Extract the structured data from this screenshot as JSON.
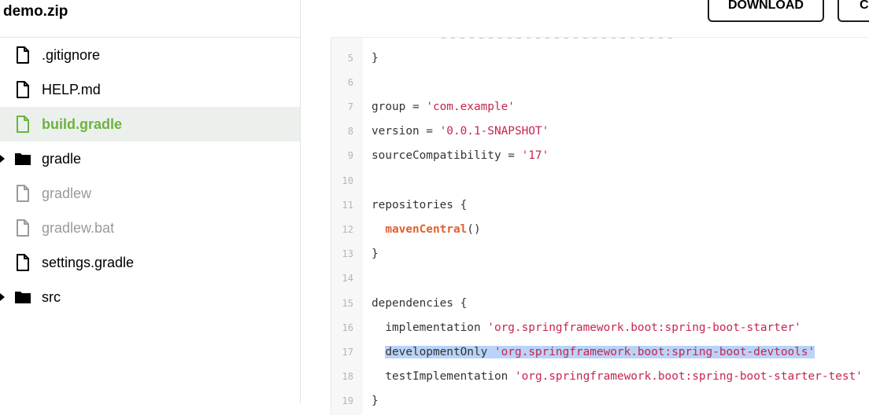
{
  "sidebar": {
    "title": "demo.zip",
    "items": [
      {
        "label": ".gitignore",
        "icon": "file-icon",
        "type": "file",
        "state": "normal"
      },
      {
        "label": "HELP.md",
        "icon": "file-icon",
        "type": "file",
        "state": "normal"
      },
      {
        "label": "build.gradle",
        "icon": "file-icon",
        "type": "file",
        "state": "selected"
      },
      {
        "label": "gradle",
        "icon": "folder-icon",
        "type": "folder",
        "state": "normal"
      },
      {
        "label": "gradlew",
        "icon": "file-icon",
        "type": "file",
        "state": "muted"
      },
      {
        "label": "gradlew.bat",
        "icon": "file-icon",
        "type": "file",
        "state": "muted"
      },
      {
        "label": "settings.gradle",
        "icon": "file-icon",
        "type": "file",
        "state": "normal"
      },
      {
        "label": "src",
        "icon": "folder-icon",
        "type": "folder",
        "state": "normal"
      }
    ]
  },
  "toolbar": {
    "download_label": "DOWNLOAD",
    "second_label": "CO"
  },
  "code": {
    "lines": [
      {
        "n": "5",
        "text": "}"
      },
      {
        "n": "6",
        "text": ""
      },
      {
        "n": "7",
        "text": "group = 'com.example'"
      },
      {
        "n": "8",
        "text": "version = '0.0.1-SNAPSHOT'"
      },
      {
        "n": "9",
        "text": "sourceCompatibility = '17'"
      },
      {
        "n": "10",
        "text": ""
      },
      {
        "n": "11",
        "text": "repositories {"
      },
      {
        "n": "12",
        "text": "  mavenCentral()"
      },
      {
        "n": "13",
        "text": "}"
      },
      {
        "n": "14",
        "text": ""
      },
      {
        "n": "15",
        "text": "dependencies {"
      },
      {
        "n": "16",
        "text": "  implementation 'org.springframework.boot:spring-boot-starter'"
      },
      {
        "n": "17",
        "text": "  developmentOnly 'org.springframework.boot:spring-boot-devtools'"
      },
      {
        "n": "18",
        "text": "  testImplementation 'org.springframework.boot:spring-boot-starter-test'"
      },
      {
        "n": "19",
        "text": "}"
      }
    ],
    "selected_line": "17"
  },
  "colors": {
    "accent_green": "#6db33f",
    "selected_bg": "#ebf0ed",
    "string": "#c7254e",
    "function": "#e0602c",
    "highlight": "#b9d3f9"
  }
}
